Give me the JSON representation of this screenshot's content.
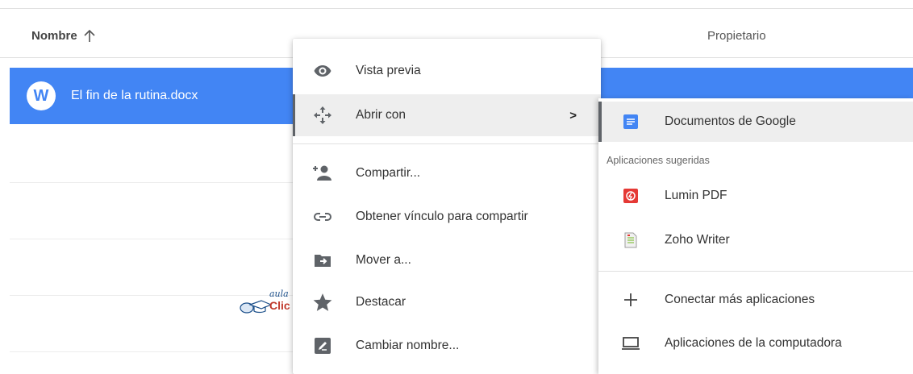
{
  "file_list": {
    "header": {
      "name_label": "Nombre",
      "owner_label": "Propietario"
    },
    "selected_file": {
      "icon_letter": "W",
      "name": "El fin de la rutina.docx"
    }
  },
  "context_menu": {
    "items": [
      {
        "label": "Vista previa",
        "icon": "eye-icon"
      },
      {
        "label": "Abrir con",
        "icon": "move-arrows-icon",
        "submenu_indicator": ">"
      },
      {
        "label": "Compartir...",
        "icon": "person-add-icon"
      },
      {
        "label": "Obtener vínculo para compartir",
        "icon": "link-icon"
      },
      {
        "label": "Mover a...",
        "icon": "folder-move-icon"
      },
      {
        "label": "Destacar",
        "icon": "star-icon"
      },
      {
        "label": "Cambiar nombre...",
        "icon": "rename-icon"
      }
    ]
  },
  "open_with_submenu": {
    "primary_app": {
      "label": "Documentos de Google",
      "icon": "google-docs-icon"
    },
    "suggested_heading": "Aplicaciones sugeridas",
    "suggested": [
      {
        "label": "Lumin PDF",
        "icon": "lumin-pdf-icon"
      },
      {
        "label": "Zoho Writer",
        "icon": "zoho-writer-icon"
      }
    ],
    "actions": [
      {
        "label": "Conectar más aplicaciones",
        "icon": "plus-icon"
      },
      {
        "label": "Aplicaciones de la computadora",
        "icon": "laptop-icon"
      }
    ]
  },
  "watermark": {
    "line1": "aula",
    "line2": "Clic"
  },
  "colors": {
    "selection": "#4285f4",
    "menu_hover": "#eeeeee",
    "icon_gray": "#5f6368",
    "docs_blue": "#4285f4",
    "lumin_red": "#e53935"
  }
}
